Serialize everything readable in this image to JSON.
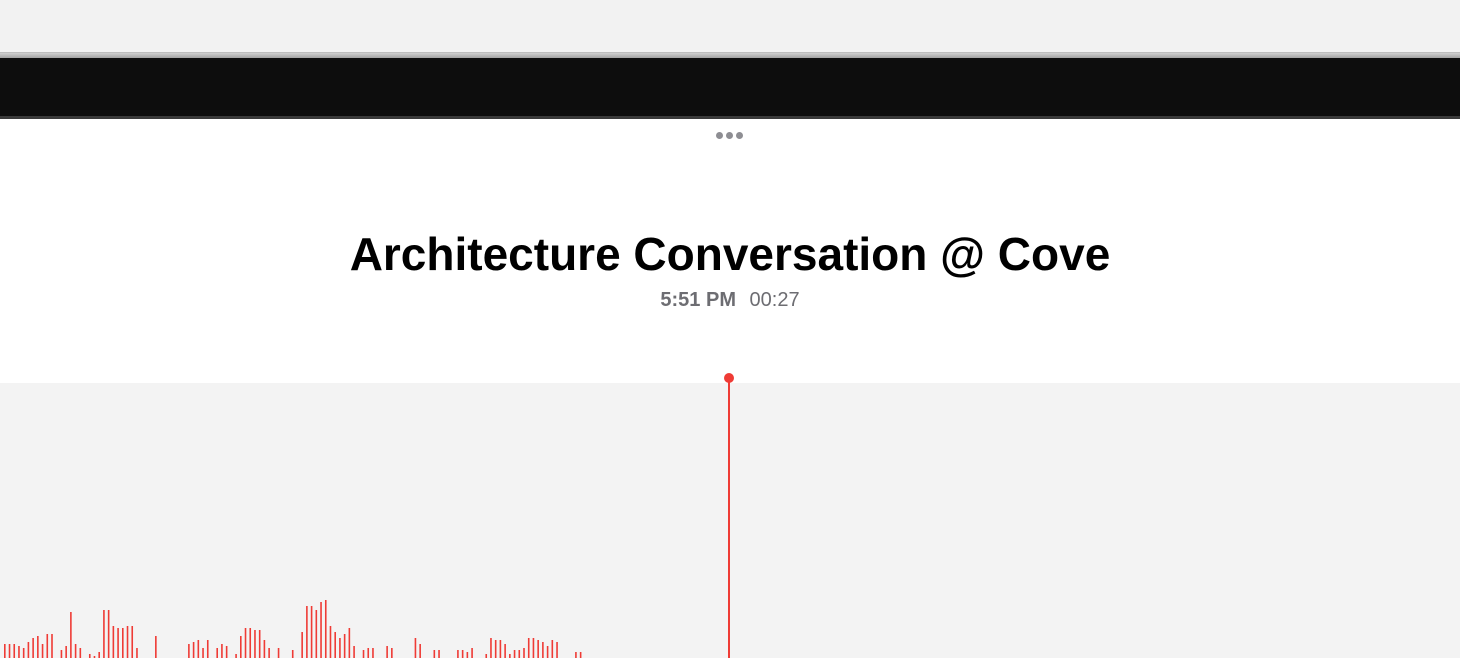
{
  "recording": {
    "title": "Architecture Conversation @ Cove",
    "time": "5:51 PM",
    "duration": "00:27"
  },
  "icons": {
    "more": "more-horizontal-icon"
  },
  "colors": {
    "accent": "#ef3b35",
    "title": "#000000",
    "meta": "#6d6d72",
    "panel": "#ffffff",
    "wave_background": "#f3f3f3",
    "top_bar": "#0d0d0d"
  }
}
